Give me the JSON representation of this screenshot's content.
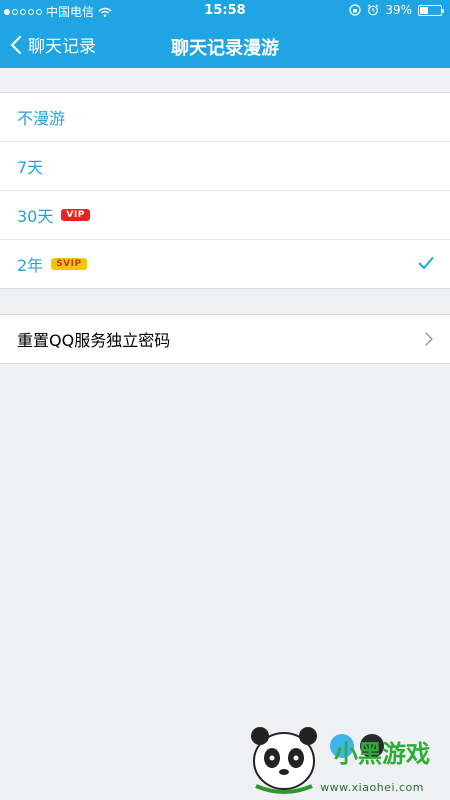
{
  "status_bar": {
    "carrier": "中国电信",
    "time": "15:58",
    "battery": "39%"
  },
  "nav": {
    "back_label": "聊天记录",
    "title": "聊天记录漫游"
  },
  "options": [
    {
      "label": "不漫游",
      "badge": ""
    },
    {
      "label": "7天",
      "badge": ""
    },
    {
      "label": "30天",
      "badge": "VIP"
    },
    {
      "label": "2年",
      "badge": "SVIP",
      "selected": true
    }
  ],
  "reset_password": {
    "label": "重置QQ服务独立密码"
  },
  "watermark": {
    "brand": "小黑游戏",
    "url": "www.xiaohei.com"
  },
  "colors": {
    "accent": "#1fa5e3",
    "link_text": "#2aa0d6",
    "background": "#eff0f4",
    "vip_badge": "#e8221e",
    "svip_badge": "#f6c50b"
  }
}
